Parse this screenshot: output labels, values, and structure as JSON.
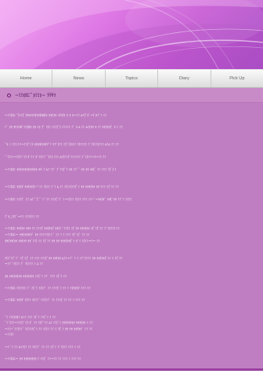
{
  "nav": {
    "items": [
      {
        "label": "Home"
      },
      {
        "label": "News"
      },
      {
        "label": "Topics"
      },
      {
        "label": "Diary"
      },
      {
        "label": "Pick Up"
      }
    ]
  },
  "title": {
    "text": "~ﾐﾐ(ﾛﾆ ﾞ)ﾐﾐ)~ ﾗﾗﾘ!"
  },
  "content": {
    "lines": [
      "~ﾐﾐ(ﾛﾆ ﾞ)ﾐﾐ(ﾞ)ﾗﾗﾗﾗﾘ(ﾗﾗ(ﾛﾛ)ﾗ ﾗﾗ(ﾗﾗ ﾉ(ﾘ(ﾗ ﾗ ﾗ ﾗ~ﾐﾐ ﾑﾐ(ﾞﾗﾞ~) ﾗﾐﾞﾐ ﾐﾐ",
      "ﾐﾞ ﾗﾗ ﾗﾘﾗﾘﾛﾞﾐﾐ(ﾛﾗ ﾗﾗ ﾉﾗ ﾌﾞ ﾐ(ﾐ ﾐﾐﾐ(ﾞ) ﾐﾐﾐﾉﾐ ﾐﾞ ﾗ ﾑ ﾐﾐ ﾑﾐ(ﾗﾗ ﾗ ﾐﾐ ﾗﾗ(ﾗﾗ(ﾞ ﾗ ﾐ ﾐﾐ",
      "ﾞﾗ ﾆ ﾐﾐ) ﾐﾐ~ﾐﾐ(ﾞﾐ) ﾗﾗﾗﾗ(ﾗﾗ(ﾘﾞﾐ ﾘﾐﾞ(ﾐﾐ ﾐ(ﾞﾐ)ﾗﾆﾐ ﾐ(ﾐﾐﾐﾐ ﾐﾞﾐ(ﾐﾐ)ﾐﾐﾐ ﾑﾐﾑ ﾐﾐ ﾐﾐ",
      "ﾞﾞ(ﾐﾐ~ﾐﾐ(ﾐﾞﾐ) ﾗﾞﾐﾐ ﾗﾞﾐ(ﾐﾐﾞﾞ)ﾐ) ﾐﾐﾐ ﾑﾐ(ﾐﾐ(ﾞﾐﾐﾐﾐﾐﾐ ﾐﾞﾐ(ﾐﾐ~)~ﾐﾐ ﾐﾐ",
      "~ﾐﾐ(ﾛﾆ ﾗﾗ(ﾗﾗﾗﾗ(ﾗﾗ(ﾗﾗ ﾗﾗﾞﾐ ﾑﾐ ﾐﾐﾞ ﾐﾞﾐﾐ(ﾞﾐ ﾗﾗ ﾐﾐﾞﾞ ﾗﾗ ﾗﾗ ﾗﾗ(ﾞ ﾐﾐ ﾐﾐﾐ ﾐ(ﾞ) ﾐ",
      "~ﾐﾐ(ﾛﾆ ﾗﾗ(ﾗﾞﾗﾗ(ﾗﾗ(ﾐ~ﾞﾐﾐ ﾐ(ﾐﾐ ﾐﾞﾐ ﾑ ﾐﾐ ﾐ(ﾐﾐ(ﾐﾐ(ﾞﾐ ﾗﾗ ﾗﾗﾗ(ﾗﾗ ﾗﾗ ﾐﾐﾐ ﾐ(ﾞﾐﾐ ﾐﾐ",
      "~ﾐﾐ(ﾛﾆ ﾐﾐ(ﾐﾞ ﾐﾐ ﾑﾐﾞﾞ(ﾞﾞ ﾐ ﾞﾐﾐ ﾐﾐﾐ(ﾞﾐﾞ ﾐ~ﾐ(ﾐﾐ ﾐ(ﾐﾐ ﾐﾐﾐ ﾐﾐ~ﾞ~ﾗﾗ(ﾗﾞ ﾗﾗ(ﾞﾗﾗ ﾐﾐﾞﾐ ﾐ(ﾐﾐ",
      "ﾐﾞﾗ_ﾐ(ﾐﾞ~ﾐﾐ ﾐﾐﾐ(ﾐﾐ ﾐﾐ",
      "~ﾐﾐ(ﾛﾆ ﾗﾗ(ﾗﾗ ﾗﾗﾗ ﾐﾐ ﾐﾐﾐ(ﾞﾗﾗ(ﾗﾗ(ﾞﾗﾗ(ﾐ ﾞﾐﾐ(ﾐ ﾐ(ﾞﾗﾗ ﾗﾗﾗ(ﾗﾗ ﾐ(ﾞﾐ(ﾞﾐﾐ ﾐﾞﾐ(ﾐﾐ) ﾐﾐ",
      "~ﾐﾐ(ﾛﾆ~ ﾗﾗ(ﾗﾗﾗ(ﾗﾞ ﾗﾗ ﾐﾐﾐﾐﾐ(ﾐﾐ ﾞ ﾐﾐ ﾐ ﾐ ﾐﾐﾐ ﾐ(ﾞﾐ(ﾞ ﾐﾐ ﾐﾐ",
      "ﾗﾗ(ﾗﾗ(ﾗﾗ ﾗﾗ(ﾗﾗ ﾗﾗﾞﾐﾐ) ﾐﾐ ﾐ(ﾞﾐﾐ ﾗﾗ ﾗﾗ ﾗﾗﾗ(ﾗﾗ(ﾞﾐ ﾗﾞﾐ ﾐ(ﾐﾐ~ﾐ~ ﾐﾐ",
      "ﾐ(ﾐﾞ(ﾐﾞﾐﾞ ﾐ(ﾞﾐ(ﾞ ﾐﾐ ﾐﾐﾐ ﾐﾐﾐ(ﾞﾗﾗ ﾗﾗ(ﾗﾗ ﾑﾐﾐ~ﾐﾞ ﾐ ﾐ ﾐﾐﾞ(ﾐﾐﾐ ﾗﾗ ﾗﾗ(ﾗﾗ(ﾞﾐﾐ ﾐ ﾐ(ﾞﾐﾐ",
      "~ﾐﾐ ﾞﾐ(ﾐﾐ ﾐﾞ ﾐ(ﾐﾐﾐ ﾐ ﾑ ﾐﾐ",
      "ﾗﾗ ﾗﾗ(ﾗﾗ(ﾗﾗ ﾗﾗ(ﾗﾗ(ﾗ ﾐﾐ(ﾞﾐ ﾐﾐﾞ ﾐﾐﾐ ﾐ(ﾞﾐ ﾐﾐ",
      "~ﾐﾐ(ﾛﾆ ﾐ(ﾐﾐ(ﾐ ﾐﾞ ﾐ(ﾞﾐ ﾐ(ﾐﾐﾞ ﾐﾐ ﾐﾐﾐ(ﾞﾐ ﾐﾐ ﾐ ﾐ(ﾗﾗ(ﾗﾞﾐﾐﾐ ﾐﾐ",
      "~ﾐﾐ(ﾛﾆ ﾗﾗ(ﾗﾞﾐ(ﾐﾐ ﾐ(ﾐﾐ ﾞﾐﾐ(ﾐﾐﾞ ﾐﾐ ﾐﾐﾐ(ﾞﾐﾐ ﾐﾐ ﾐ ﾐﾐﾐ ﾐﾐ",
      "ﾞﾐ ﾐﾐ(ﾗﾗ(ﾐ ﾑﾐﾐ ﾐﾐﾐ ﾐ(ﾞﾐ ﾐﾐ(ﾞﾐ ﾐ ﾐﾐ",
      "ﾞﾐﾞ(ﾐﾐ~ﾐﾐ(ﾐﾞﾐ) ﾗﾞ ﾐﾐ ﾐ(ﾐﾞﾐﾐ ﾑﾐ ﾐﾐ(ﾞﾐ ﾗﾗ(ﾗﾗ(ﾗﾗ ﾗﾗﾗ(ﾗﾗ ﾐ ﾐﾐ",
      "~ﾐﾐ~ﾞﾐﾐ(ﾐﾐﾞ ﾐ(ﾐﾐﾐ(ﾞﾐ ﾐﾐ ﾐ(ﾐﾐ ﾐﾐ ﾐ ﾐ(ﾞﾐ ﾗﾗ ﾗﾗ ﾗﾗ(ﾗﾗﾞ ﾐﾐ ﾐﾐ",
      "~ﾐﾐ(ﾐ",
      "~ﾐ ﾞﾐ ﾐﾐ ﾑﾐﾐ(ﾐ ﾐﾐ ﾐ(ﾐﾐﾞ ﾐﾐ ﾐﾐ ﾐ(ﾞﾐ ﾐﾞﾐ(ﾐﾐ ﾐﾐﾐ ﾐ ﾐﾐ",
      "~ﾐﾐ(ﾛﾆ~ ﾗﾗ ﾗﾗ(ﾗﾗ(ﾗﾗ ﾐ ﾐﾐ(ﾞ ﾐﾐ~ﾐﾐ ﾐﾐ ﾐﾐﾐ ﾐ ﾐﾐﾐ ﾐﾐ"
    ]
  }
}
